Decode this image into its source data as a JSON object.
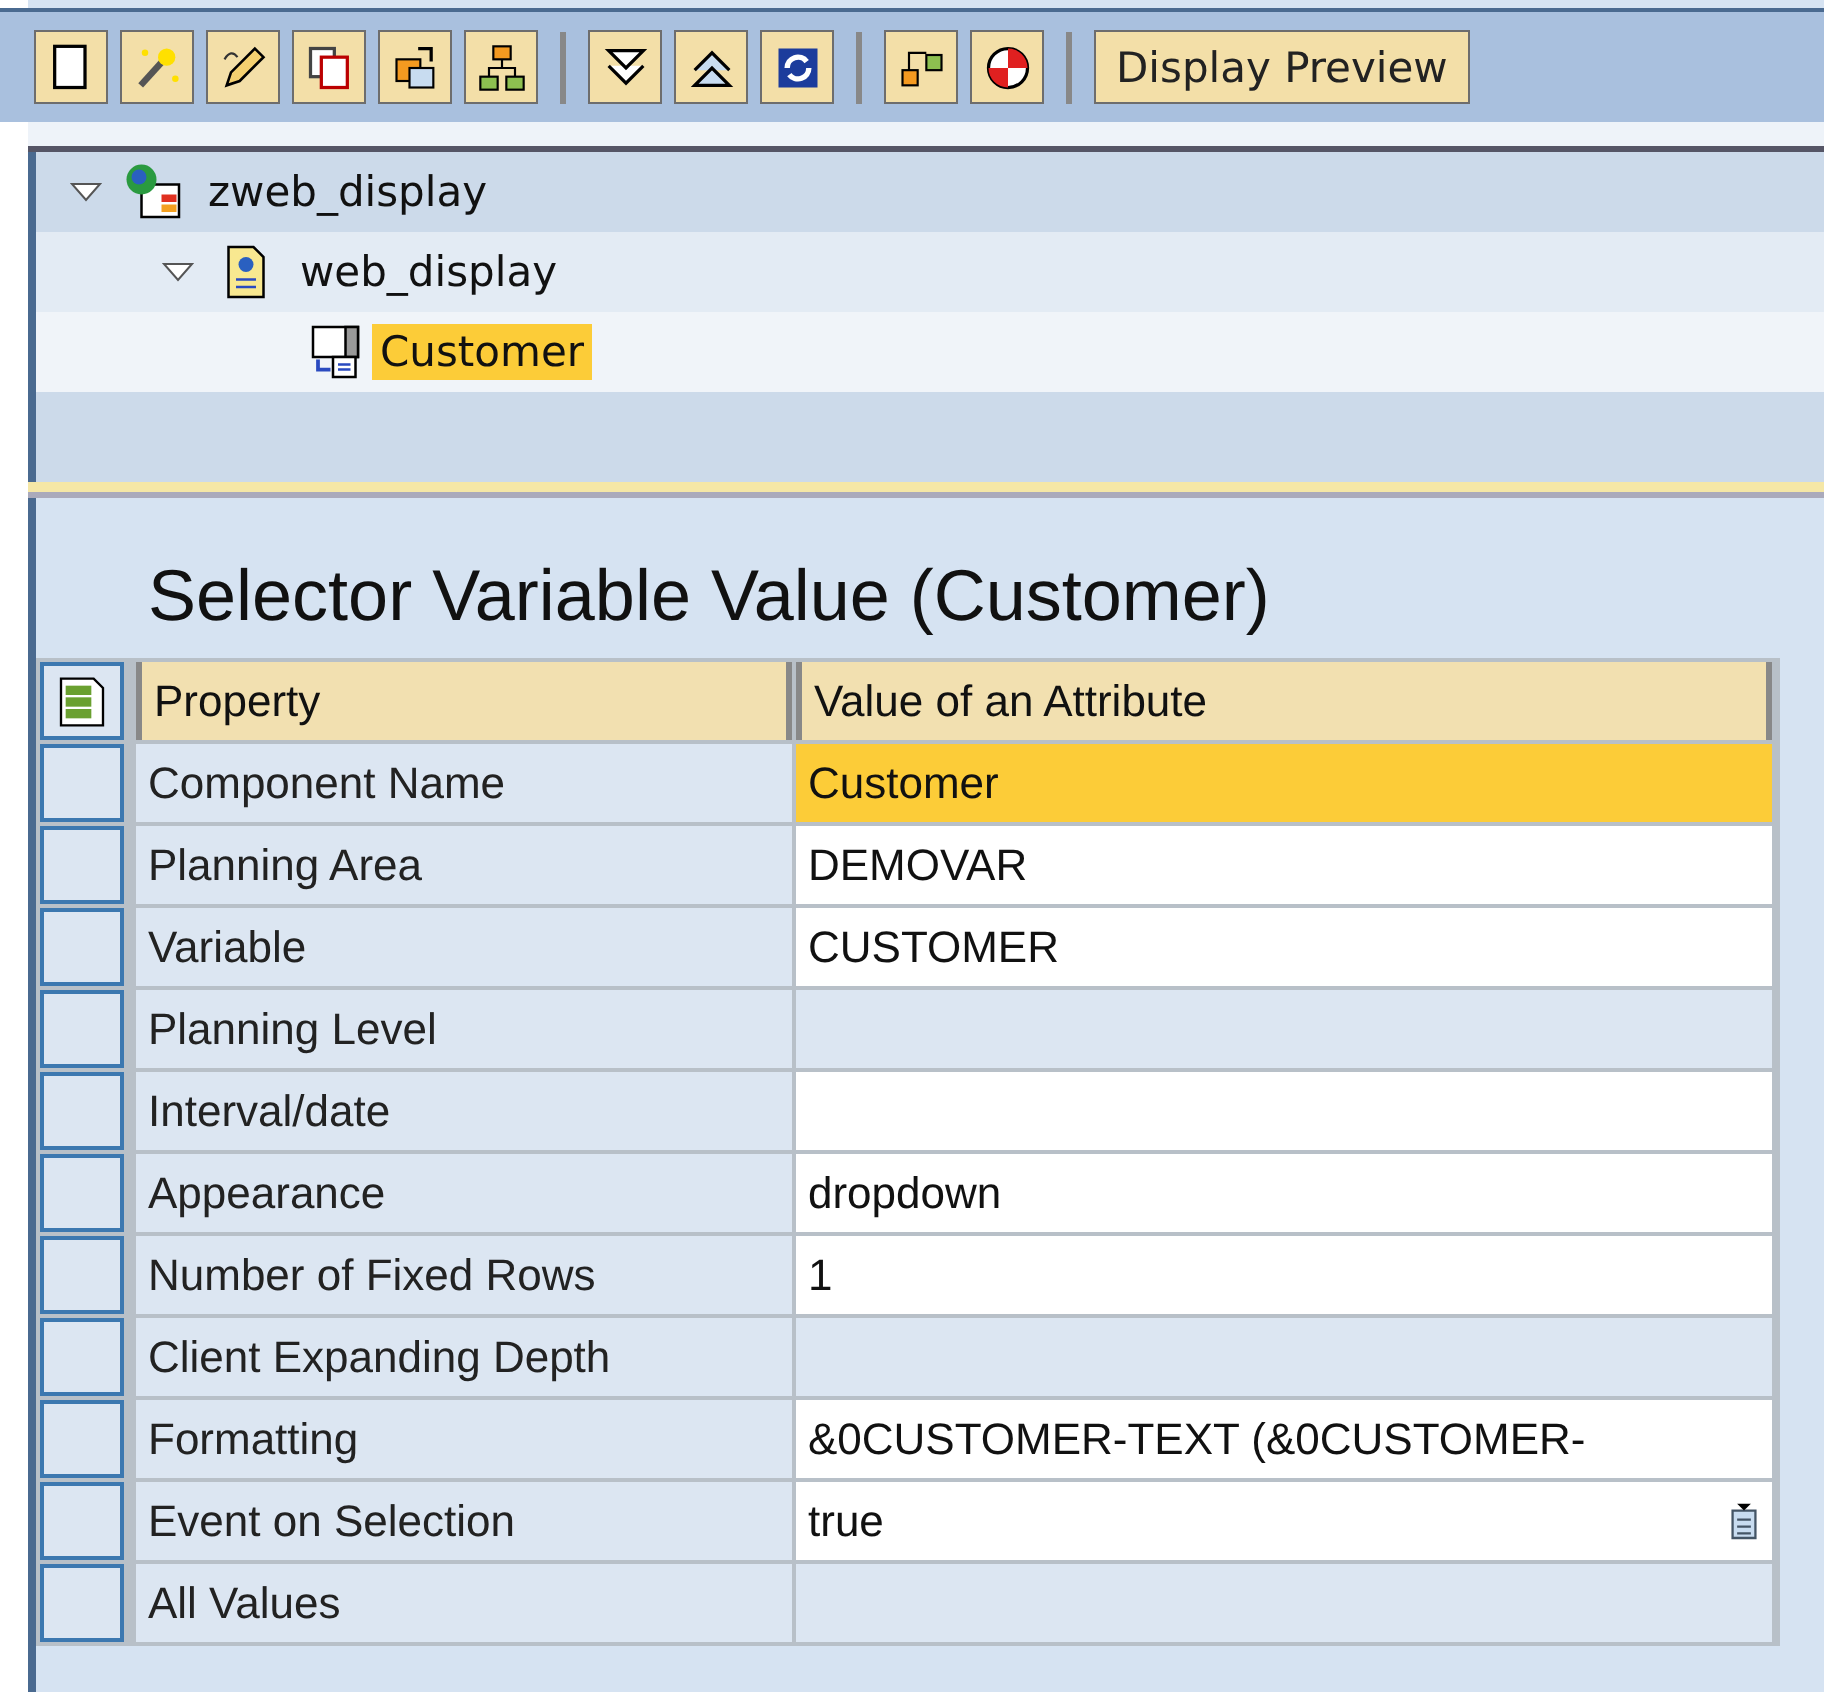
{
  "toolbar": {
    "text_button": "Display Preview"
  },
  "tree": {
    "items": [
      {
        "label": "zweb_display",
        "expanded": true,
        "selected": false,
        "children": [
          {
            "label": "web_display",
            "expanded": true,
            "selected": false,
            "children": [
              {
                "label": "Customer",
                "selected": true
              }
            ]
          }
        ]
      }
    ]
  },
  "panel": {
    "title": "Selector Variable Value (Customer)",
    "table": {
      "columns": [
        "Property",
        "Value of an Attribute"
      ],
      "rows": [
        {
          "property": "Component Name",
          "value": "Customer",
          "selected": true,
          "editable": true
        },
        {
          "property": "Planning Area",
          "value": "DEMOVAR",
          "selected": false,
          "editable": true
        },
        {
          "property": "Variable",
          "value": "CUSTOMER",
          "selected": false,
          "editable": true
        },
        {
          "property": "Planning Level",
          "selected": false,
          "editable": false
        },
        {
          "property": "Interval/date",
          "selected": false,
          "editable": true
        },
        {
          "property": "Appearance",
          "value": "dropdown",
          "selected": false,
          "editable": true
        },
        {
          "property": "Number of Fixed Rows",
          "value": "1",
          "selected": false,
          "editable": true
        },
        {
          "property": "Client Expanding Depth",
          "selected": false,
          "editable": false
        },
        {
          "property": "Formatting",
          "value": "&0CUSTOMER-TEXT (&0CUSTOMER-",
          "selected": false,
          "editable": true
        },
        {
          "property": "Event on Selection",
          "value": "true",
          "selected": false,
          "editable": true,
          "value_help": true
        },
        {
          "property": "All Values",
          "selected": false,
          "editable": false
        }
      ]
    }
  }
}
